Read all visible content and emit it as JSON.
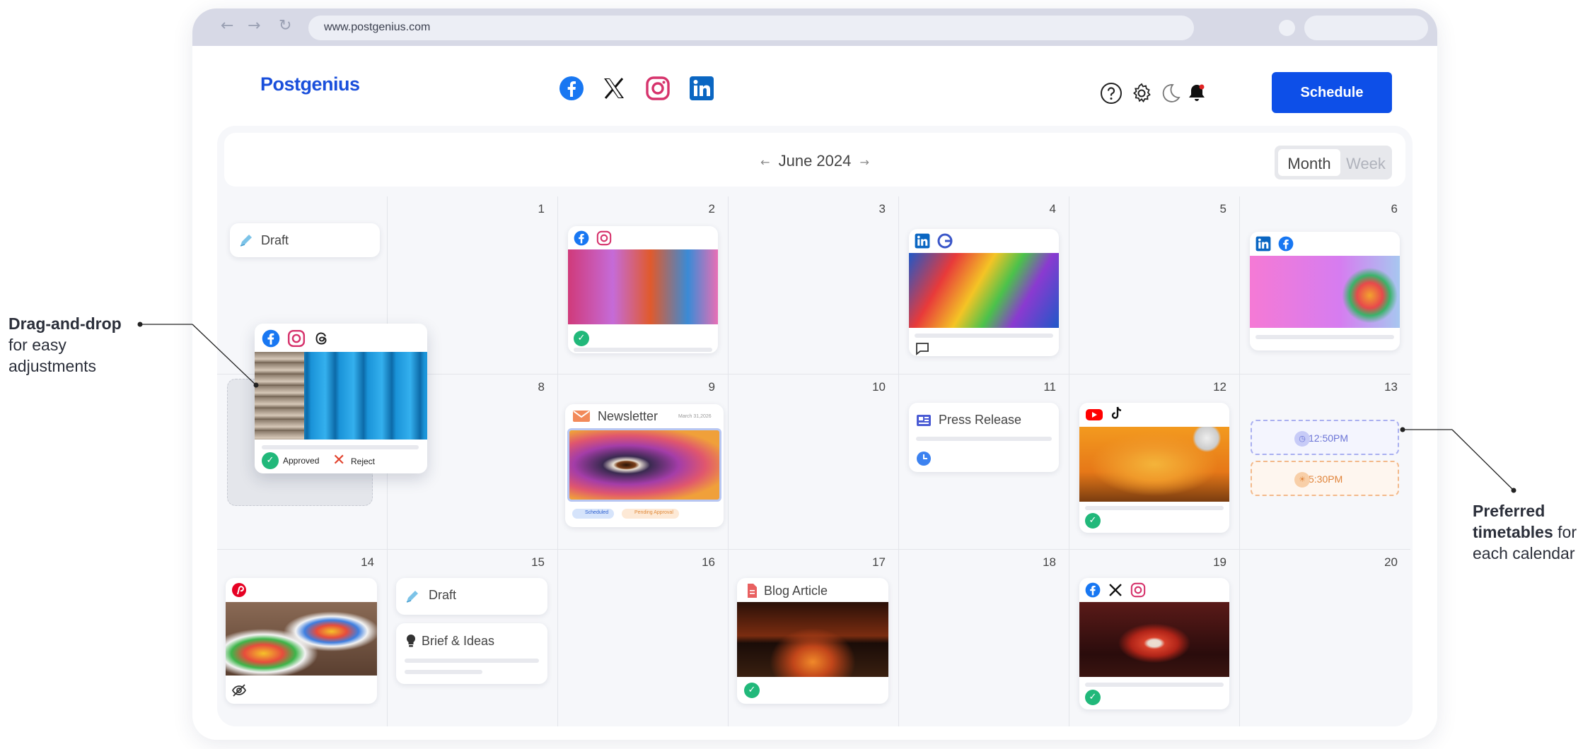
{
  "browser": {
    "url": "www.postgenius.com",
    "back_glyph": "←",
    "forward_glyph": "→",
    "reload_glyph": "↻"
  },
  "header": {
    "logo": "Postgenius",
    "social_icons": [
      "facebook-icon",
      "x-icon",
      "instagram-icon",
      "linkedin-icon"
    ],
    "header_icons": [
      "help-icon",
      "gear-icon",
      "moon-icon",
      "bell-icon"
    ],
    "schedule_label": "Schedule"
  },
  "calendar": {
    "month_label": "June 2024",
    "prev_glyph": "←",
    "next_glyph": "→",
    "view_month": "Month",
    "view_week": "Week",
    "days": {
      "d1": "1",
      "d2": "2",
      "d3": "3",
      "d4": "4",
      "d5": "5",
      "d6": "6",
      "d8": "8",
      "d9": "9",
      "d10": "10",
      "d11": "11",
      "d12": "12",
      "d13": "13",
      "d14": "14",
      "d15": "15",
      "d16": "16",
      "d17": "17",
      "d18": "18",
      "d19": "19",
      "d20": "20"
    },
    "posts": {
      "draft_label": "Draft",
      "approved_label": "Approved",
      "reject_label": "Reject",
      "newsletter_label": "Newsletter",
      "newsletter_date": "March 31,2026",
      "scheduled_badge": "Scheduled",
      "pending_badge": "Pending Approval",
      "press_release_label": "Press Release",
      "time_slot_1": "12:50PM",
      "time_slot_2": "5:30PM",
      "draft_15_label": "Draft",
      "brief_label": "Brief & Ideas",
      "blog_label": "Blog Article"
    }
  },
  "annotations": {
    "dnd_title": "Drag-and-drop",
    "dnd_sub_1": "for easy",
    "dnd_sub_2": "adjustments",
    "pref_title_1": "Preferred",
    "pref_title_2": "timetables",
    "pref_sub_1": " for",
    "pref_sub_2": "each calendar"
  },
  "colors": {
    "accent": "#0d4fe8",
    "logo": "#1a4fdb",
    "success": "#21b87a",
    "slot_blue": "#8c92e0",
    "slot_orange": "#f0a060"
  }
}
